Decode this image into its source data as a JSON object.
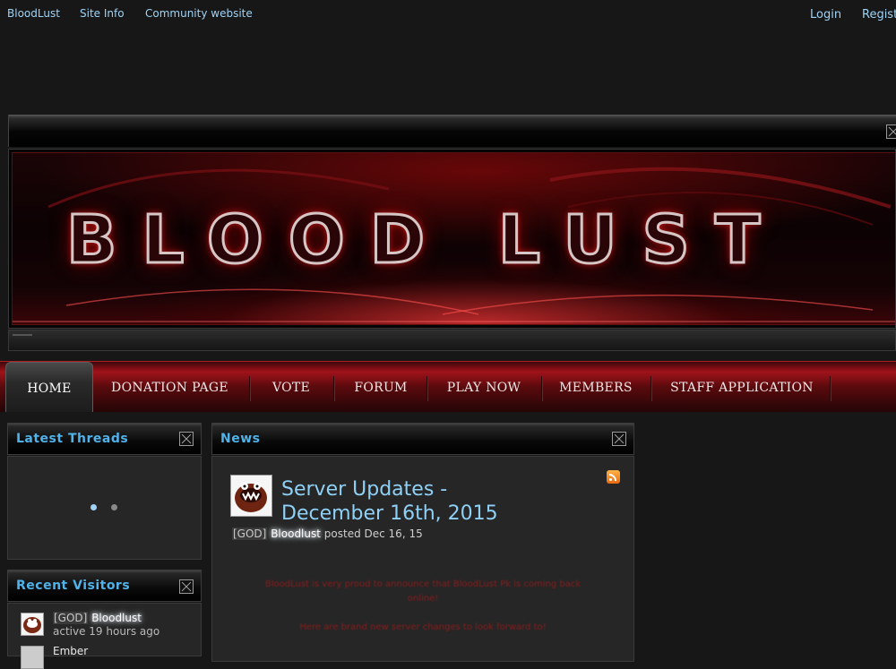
{
  "topnav": {
    "links": [
      "BloodLust",
      "Site Info",
      "Community website"
    ],
    "login": "Login",
    "register": "Regist"
  },
  "banner": {
    "title": "BLOOD LUST"
  },
  "nav": {
    "items": [
      "HOME",
      "DONATION PAGE",
      "VOTE",
      "FORUM",
      "PLAY NOW",
      "MEMBERS",
      "STAFF APPLICATION"
    ],
    "active": "HOME"
  },
  "latest_threads": {
    "title": "Latest Threads"
  },
  "recent_visitors": {
    "title": "Recent Visitors",
    "visitors": [
      {
        "rank": "[GOD]",
        "name": "Bloodlust",
        "meta": "active 19 hours ago"
      },
      {
        "rank": "",
        "name": "Ember",
        "meta": ""
      }
    ]
  },
  "news": {
    "title": "News",
    "post": {
      "title": "Server Updates - December 16th, 2015",
      "rank": "[GOD]",
      "author": "Bloodlust",
      "posted": "posted Dec 16, 15",
      "lines": [
        "BloodLust is very proud to announce that BloodLust Pk is coming back",
        "online!",
        "Here are brand new server changes to look forward to!"
      ]
    }
  },
  "colors": {
    "accent": "#4fb2ea",
    "link": "#9fd3f5",
    "nav_red": "#a0131a",
    "background": "#171717"
  },
  "icons": [
    "expand-icon",
    "rss-icon",
    "avatar"
  ]
}
